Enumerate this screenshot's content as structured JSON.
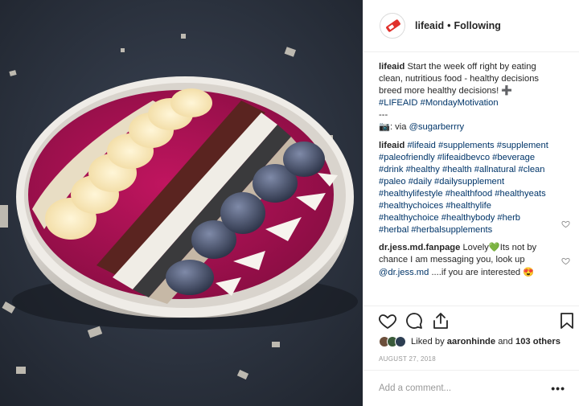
{
  "post": {
    "image_alt": "Smoothie bowl with banana, buckwheat, cacao nibs, coconut, chia and frozen blackberries"
  },
  "header": {
    "username": "lifeaid",
    "separator": "•",
    "follow_status": "Following"
  },
  "caption": {
    "user": "lifeaid",
    "text": "Start the week off right by eating clean, nutritious food - healthy decisions breed more healthy decisions! ➕",
    "tags": "#LIFEAID #MondayMotivation",
    "divider": "---",
    "via_icon": "📷",
    "via_text": ": via",
    "via_user": "@sugarberrry"
  },
  "comments": [
    {
      "user": "lifeaid",
      "text": "#lifeaid #supplements #supplement #paleofriendly #lifeaidbevco #beverage #drink #healthy #health #allnatural #clean #paleo #daily #dailysupplement #healthylifestyle #healthfood #healthyeats #healthychoices #healthylife #healthychoice #healthybody #herb #herbal #herbalsupplements"
    },
    {
      "user": "dr.jess.md.fanpage",
      "text_before": "Lovely",
      "emoji": "💚",
      "text_after": "Its not by chance I am messaging you, look up",
      "mention": "@dr.jess.md",
      "text_end": "....if you are interested 😍"
    }
  ],
  "likes": {
    "prefix": "Liked by",
    "user": "aaronhinde",
    "middle": "and",
    "others": "103 others"
  },
  "date": "AUGUST 27, 2018",
  "add_comment": {
    "placeholder": "Add a comment...",
    "more": "•••"
  },
  "icons": {
    "like": "heart-icon",
    "comment": "comment-icon",
    "share": "share-icon",
    "save": "bookmark-icon"
  },
  "colors": {
    "link": "#003569",
    "brand_red": "#e0302b",
    "muted": "#999999",
    "border": "#efefef"
  }
}
